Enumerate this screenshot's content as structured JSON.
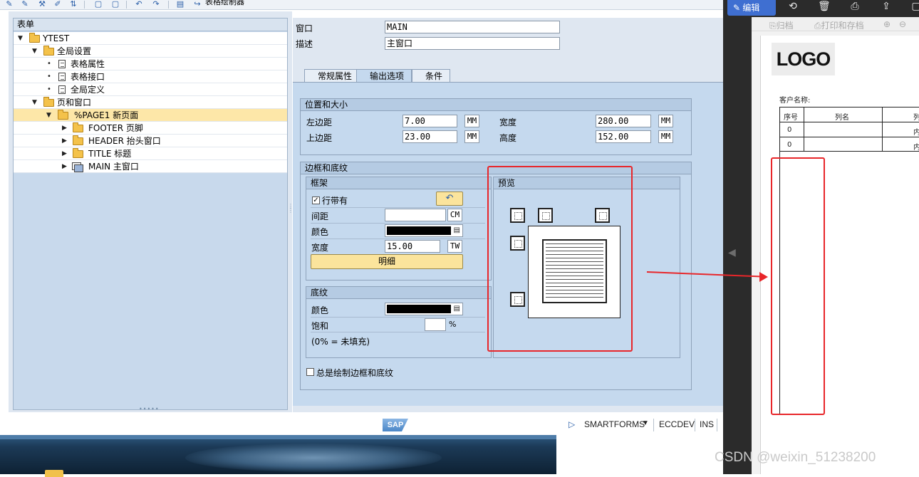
{
  "toolbar": {
    "form_painter_label": "表格绘制器"
  },
  "tree": {
    "header": "表单",
    "items": [
      {
        "label": "YTEST"
      },
      {
        "label": "全局设置"
      },
      {
        "label": "表格属性"
      },
      {
        "label": "表格接口"
      },
      {
        "label": "全局定义"
      },
      {
        "label": "页和窗口"
      },
      {
        "label": "%PAGE1 新页面"
      },
      {
        "label": "FOOTER 页脚"
      },
      {
        "label": "HEADER 抬头窗口"
      },
      {
        "label": "TITLE 标题"
      },
      {
        "label": "MAIN 主窗口"
      }
    ]
  },
  "window": {
    "window_label": "窗口",
    "window_value": "MAIN",
    "desc_label": "描述",
    "desc_value": "主窗口"
  },
  "tabs": [
    {
      "label": "常规属性"
    },
    {
      "label": "输出选项"
    },
    {
      "label": "条件"
    }
  ],
  "position": {
    "title": "位置和大小",
    "left_label": "左边距",
    "left_value": "7.00",
    "left_unit": "MM",
    "top_label": "上边距",
    "top_value": "23.00",
    "top_unit": "MM",
    "width_label": "宽度",
    "width_value": "280.00",
    "width_unit": "MM",
    "height_label": "高度",
    "height_value": "152.00",
    "height_unit": "MM"
  },
  "border": {
    "title": "边框和底纹",
    "frame_title": "框架",
    "with_line_label": "行带有",
    "spacing_label": "间距",
    "spacing_value": "",
    "spacing_unit": "CM",
    "color_label": "颜色",
    "width_label": "宽度",
    "width_value": "15.00",
    "width_unit": "TW",
    "detail_button": "明细",
    "shading_title": "底纹",
    "shading_color_label": "颜色",
    "saturation_label": "饱和",
    "saturation_value": "",
    "saturation_unit": "%",
    "note": "(0% = 未填充)",
    "preview_title": "预览",
    "always_draw_label": "总是绘制边框和底纹"
  },
  "statusbar": {
    "logo": "SAP",
    "transaction": "SMARTFORMS",
    "system": "ECCDEV",
    "mode": "INS"
  },
  "viewer": {
    "edit_button": "编辑",
    "sub_archive": "归档",
    "sub_print_archive": "打印和存档",
    "logo": "LOGO",
    "customer_label": "客户名称:",
    "col_seq": "序号",
    "col_name": "列名",
    "col_third": "列",
    "row1_seq": "0",
    "row1_third": "内",
    "row2_seq": "0",
    "row2_third": "内"
  },
  "watermark": "CSDN @weixin_51238200",
  "colors": {
    "annotation_red": "#e8262a",
    "selected_row": "#fde7a8",
    "tab_body": "#c5d9ee",
    "edit_button": "#3f6fd1"
  }
}
